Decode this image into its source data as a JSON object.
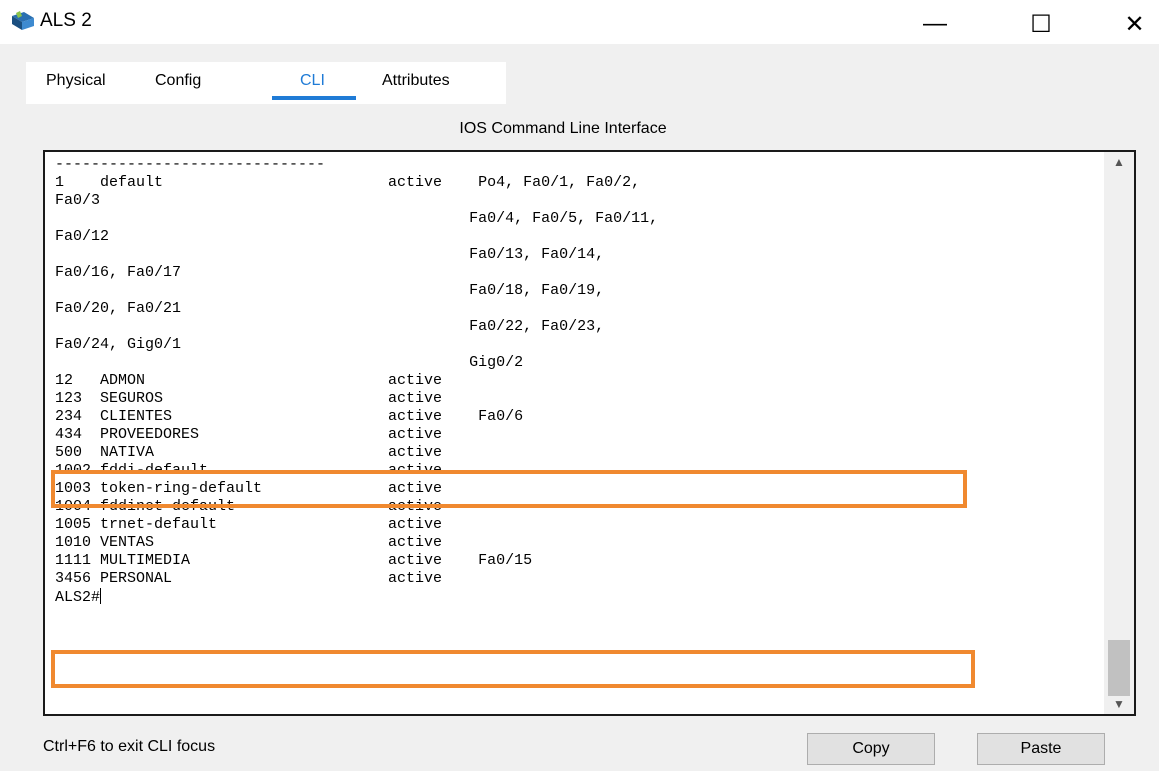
{
  "window": {
    "title": "ALS 2",
    "icon": "packet-tracer-switch-icon",
    "controls": {
      "minimize": "—",
      "maximize": "☐",
      "close": "✕"
    }
  },
  "tabs": [
    {
      "label": "Physical",
      "active": false
    },
    {
      "label": "Config",
      "active": false
    },
    {
      "label": "CLI",
      "active": true
    },
    {
      "label": "Attributes",
      "active": false
    }
  ],
  "panel": {
    "title": "IOS Command Line Interface"
  },
  "terminal": {
    "lines": [
      "------------------------------",
      "1    default                         active    Po4, Fa0/1, Fa0/2,",
      "Fa0/3",
      "                                              Fa0/4, Fa0/5, Fa0/11,",
      "Fa0/12",
      "                                              Fa0/13, Fa0/14,",
      "Fa0/16, Fa0/17",
      "                                              Fa0/18, Fa0/19,",
      "Fa0/20, Fa0/21",
      "                                              Fa0/22, Fa0/23,",
      "Fa0/24, Gig0/1",
      "                                              Gig0/2",
      "12   ADMON                           active",
      "123  SEGUROS                         active",
      "234  CLIENTES                        active    Fa0/6",
      "434  PROVEEDORES                     active",
      "500  NATIVA                          active",
      "1002 fddi-default                    active",
      "1003 token-ring-default              active",
      "1004 fddinet-default                 active",
      "1005 trnet-default                   active",
      "1010 VENTAS                          active",
      "1111 MULTIMEDIA                      active    Fa0/15",
      "3456 PERSONAL                        active",
      "ALS2#"
    ],
    "highlight_color": "#f0892f"
  },
  "footer": {
    "hint": "Ctrl+F6 to exit CLI focus",
    "copy_label": "Copy",
    "paste_label": "Paste"
  },
  "colors": {
    "accent": "#1f7bd6",
    "highlight": "#f0892f"
  }
}
